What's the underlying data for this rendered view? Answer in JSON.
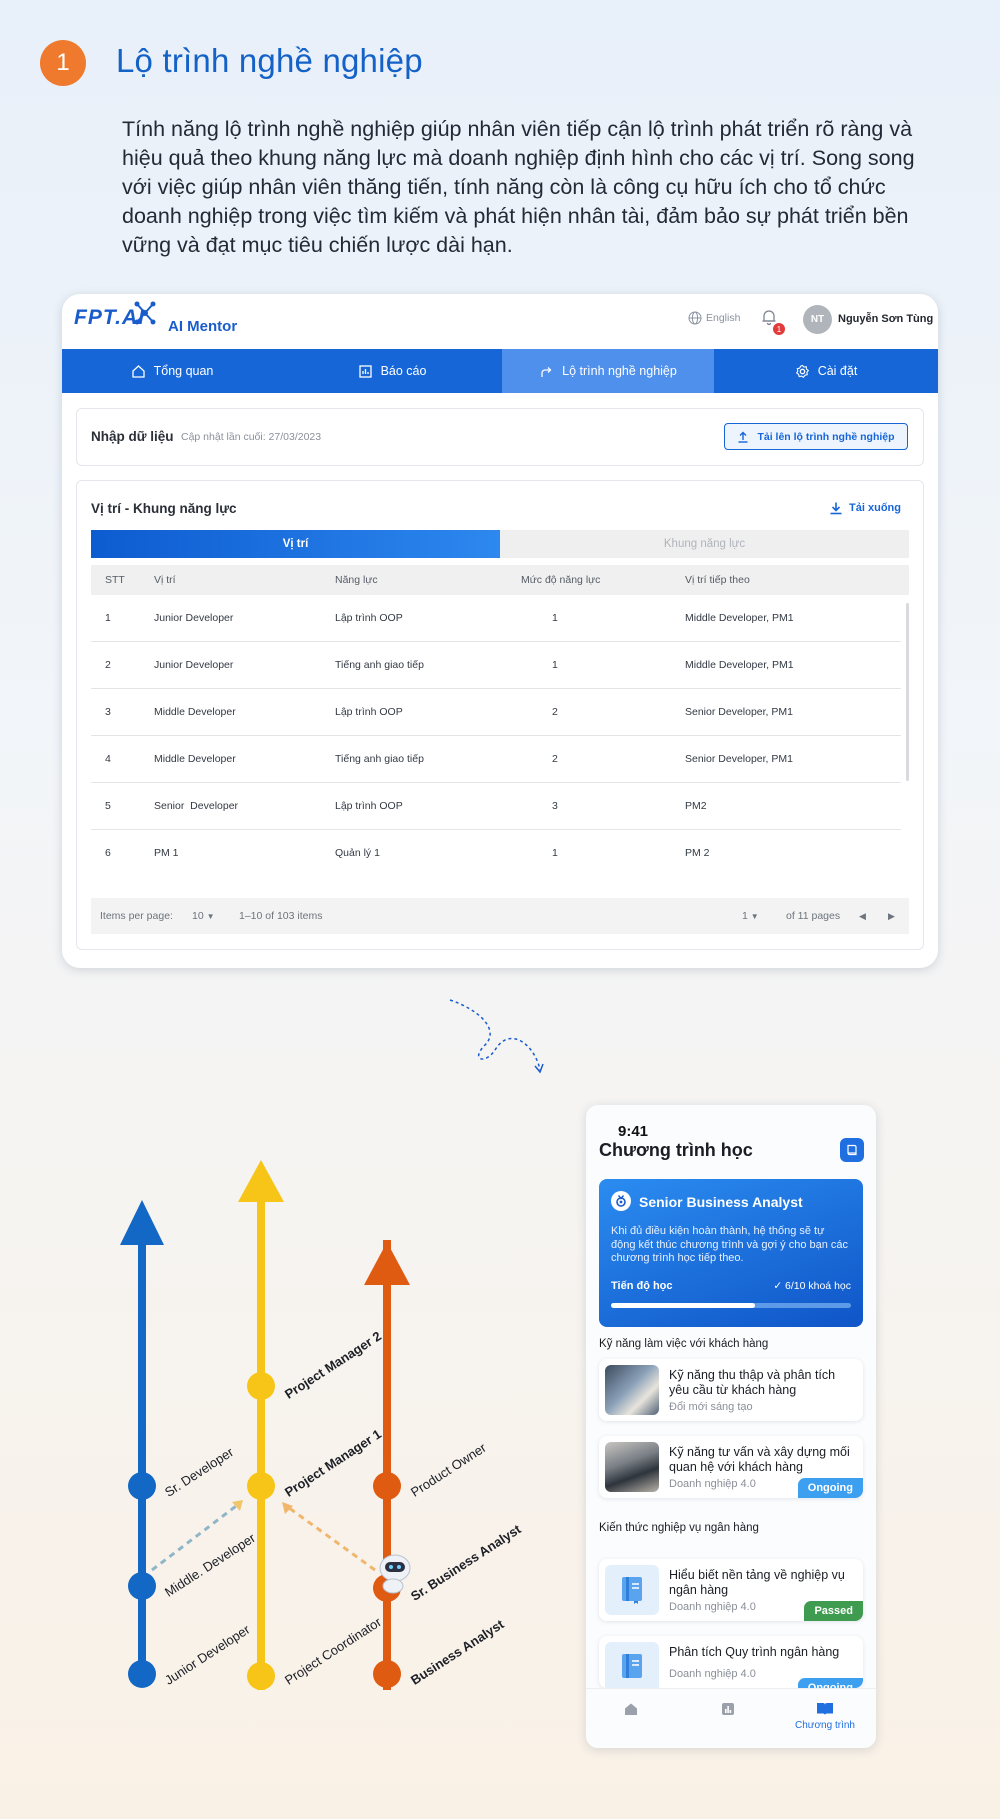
{
  "section": {
    "number": "1",
    "title": "Lộ trình nghề nghiệp",
    "intro": "Tính năng lộ trình nghề nghiệp giúp nhân viên tiếp cận lộ trình phát triển rõ ràng và hiệu quả theo khung năng lực mà doanh nghiệp định hình cho các vị trí. Song song với việc giúp nhân viên thăng tiến, tính năng còn là công cụ hữu ích cho tổ chức doanh nghiệp trong việc tìm kiếm và phát hiện nhân tài, đảm bảo sự phát triển bền vững và đạt mục tiêu chiến lược dài hạn."
  },
  "web_app": {
    "logo_fpt": "FPT.AI",
    "logo_product": "AI Mentor",
    "language": "English",
    "notification_count": "1",
    "avatar_initials": "NT",
    "user_name": "Nguyễn Sơn Tùng",
    "nav": [
      {
        "label": "Tổng quan",
        "icon": "home-icon"
      },
      {
        "label": "Báo cáo",
        "icon": "chart-icon"
      },
      {
        "label": "Lộ trình nghề nghiệp",
        "icon": "route-icon",
        "active": true
      },
      {
        "label": "Cài đặt",
        "icon": "gear-icon"
      }
    ],
    "import_panel": {
      "title": "Nhập dữ liệu",
      "last_updated": "Cập nhật lần cuối: 27/03/2023",
      "upload_button": "Tải lên lộ trình nghề nghiệp"
    },
    "framework_panel": {
      "title": "Vị trí - Khung năng lực",
      "download": "Tải xuống",
      "tabs": [
        "Vị trí",
        "Khung năng lực"
      ],
      "columns": [
        "STT",
        "Vị trí",
        "Năng lực",
        "Mức độ năng lực",
        "Vị trí tiếp theo"
      ],
      "rows": [
        [
          "1",
          "Junior Developer",
          "Lập trình OOP",
          "1",
          "Middle Developer, PM1"
        ],
        [
          "2",
          "Junior Developer",
          "Tiếng anh giao tiếp",
          "1",
          "Middle Developer, PM1"
        ],
        [
          "3",
          "Middle Developer",
          "Lập trình OOP",
          "2",
          "Senior Developer, PM1"
        ],
        [
          "4",
          "Middle Developer",
          "Tiếng anh giao tiếp",
          "2",
          "Senior Developer, PM1"
        ],
        [
          "5",
          "Senior  Developer",
          "Lập trình OOP",
          "3",
          "PM2"
        ],
        [
          "6",
          "PM 1",
          "Quản lý 1",
          "1",
          "PM 2"
        ]
      ],
      "pager": {
        "items_per_page_label": "Items per page:",
        "items_per_page": "10",
        "range": "1–10 of 103 items",
        "page": "1",
        "of_pages": "of 11 pages"
      }
    }
  },
  "career_paths": {
    "blue": [
      "Junior Developer",
      "Middle. Developer",
      "Sr. Developer"
    ],
    "yellow": [
      "Project Coordinator",
      "Project Manager 1",
      "Project Manager 2"
    ],
    "orange": [
      "Business Analyst",
      "Sr. Business Analyst",
      "Product Owner"
    ],
    "colors": {
      "blue": "#1268c4",
      "yellow": "#f7c518",
      "orange": "#df5b12"
    }
  },
  "mobile_app": {
    "time": "9:41",
    "title": "Chương trình học",
    "hero": {
      "title": "Senior Business Analyst",
      "description": "Khi đủ điều kiện hoàn thành, hệ thống sẽ tự động kết thúc chương trình và gợi ý cho bạn các chương trình học tiếp theo.",
      "progress_label": "Tiến độ học",
      "progress_text": "✓ 6/10 khoá học",
      "progress_fraction": 0.6
    },
    "sections": [
      {
        "title": "Kỹ năng làm việc với khách hàng",
        "courses": [
          {
            "name": "Kỹ năng thu thập và phân tích yêu cầu từ khách hàng",
            "tag": "Đổi mới sáng tạo",
            "badge": ""
          },
          {
            "name": "Kỹ năng tư vấn và xây dựng mối quan hệ với khách hàng",
            "tag": "Doanh nghiệp 4.0",
            "badge": "Ongoing"
          }
        ]
      },
      {
        "title": "Kiến thức nghiệp vụ ngân hàng",
        "courses": [
          {
            "name": "Hiểu biết nền tảng về nghiệp vụ ngân hàng",
            "tag": "Doanh nghiệp 4.0",
            "badge": "Passed"
          },
          {
            "name": "Phân tích Quy trình ngân hàng",
            "tag": "Doanh nghiệp 4.0",
            "badge": "Ongoing"
          }
        ]
      }
    ],
    "tabbar_active_label": "Chương trình"
  }
}
